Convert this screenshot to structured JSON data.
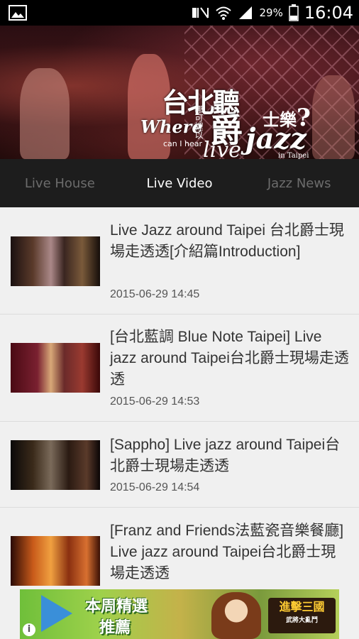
{
  "status_bar": {
    "battery_percent": "29%",
    "time": "16:04",
    "icons": [
      "image-icon",
      "mute-icon",
      "wifi-icon",
      "signal-icon",
      "battery-icon"
    ]
  },
  "banner": {
    "title_cn_top": "台北聽",
    "title_where": "Where",
    "title_small_cn": "哪可裡以",
    "title_cn_mid": "爵",
    "title_jazz": "jazz",
    "title_cn_right": "士樂",
    "title_q": "?",
    "title_can_i_hear": "can I hear",
    "title_live": "live",
    "title_in_taipei": "in Taipei"
  },
  "tabs": [
    {
      "label": "Live House",
      "active": false
    },
    {
      "label": "Live Video",
      "active": true
    },
    {
      "label": "Jazz News",
      "active": false
    }
  ],
  "videos": [
    {
      "title": "Live Jazz around Taipei 台北爵士現場走透透[介紹篇Introduction]",
      "date": "2015-06-29 14:45"
    },
    {
      "title": "[台北藍調 Blue Note Taipei] Live jazz around Taipei台北爵士現場走透透",
      "date": "2015-06-29 14:53"
    },
    {
      "title": "[Sappho] Live jazz around Taipei台北爵士現場走透透",
      "date": "2015-06-29 14:54"
    },
    {
      "title": "[Franz and Friends法藍瓷音樂餐廳] Live jazz around Taipei台北爵士現場走透透",
      "date": ""
    }
  ],
  "ad": {
    "line1": "本周精選",
    "line2": "推薦",
    "game_title": "進擊三國",
    "game_sub": "武將大亂鬥",
    "info": "i"
  },
  "colors": {
    "tab_bar": "#1d1d1d",
    "tab_active": "#ffffff",
    "tab_inactive": "#6c6c6c",
    "list_bg": "#f0f0f0"
  }
}
